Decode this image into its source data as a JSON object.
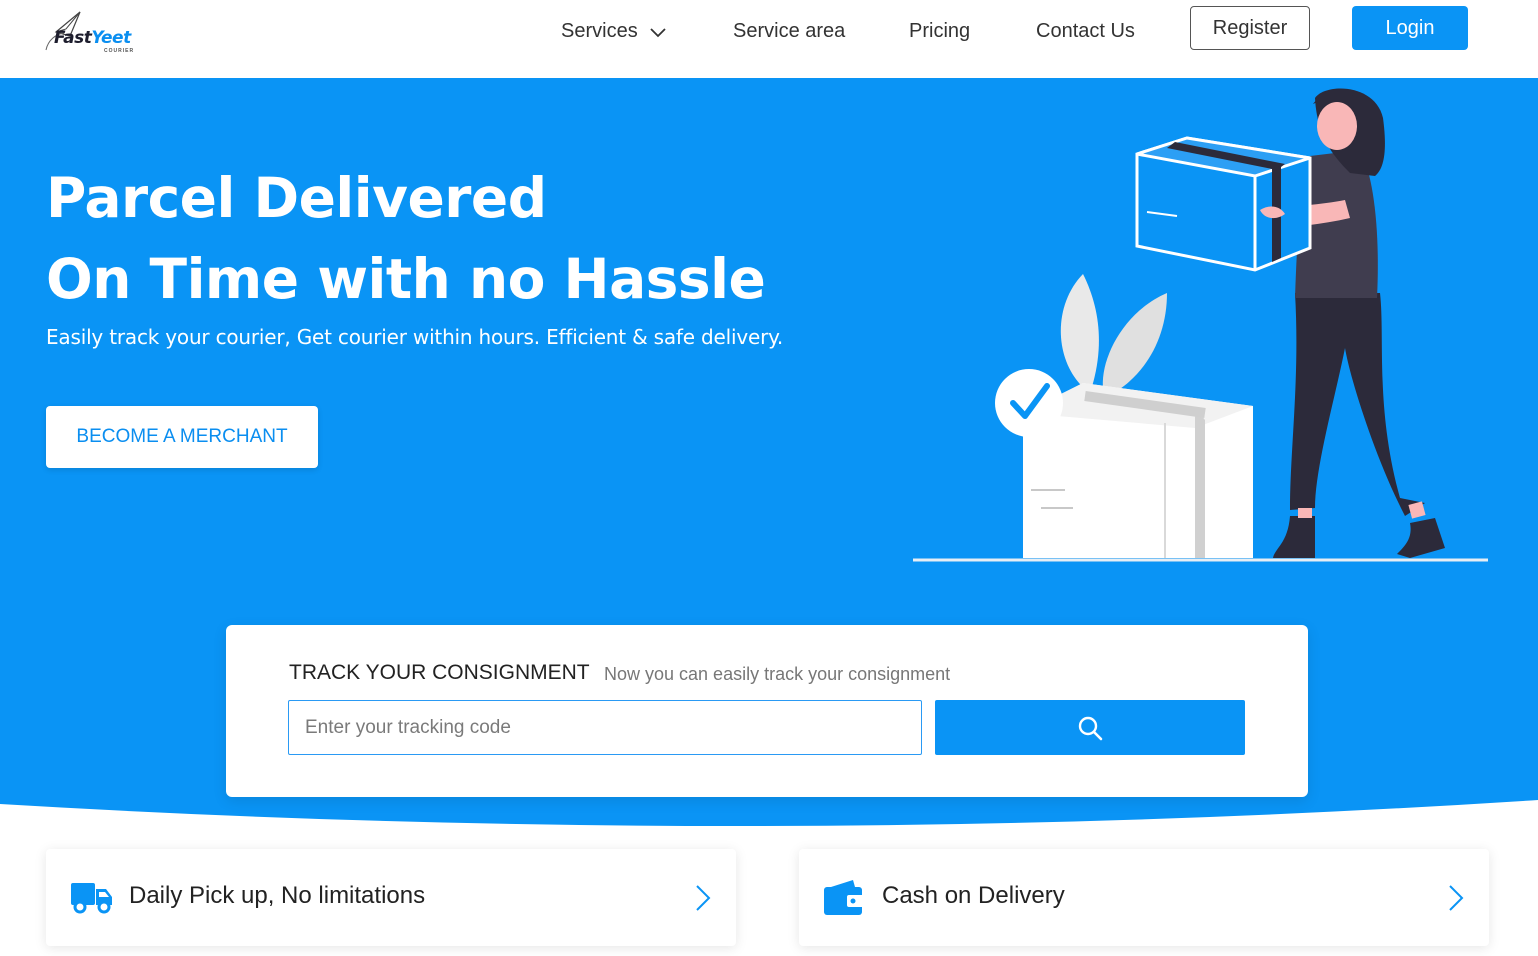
{
  "brand": {
    "name_part1": "Fast",
    "name_part2": "Yeet",
    "tagline": "COURIER",
    "primary_color": "#0a94f5"
  },
  "nav": {
    "items": [
      {
        "label": "Services",
        "has_dropdown": true,
        "icon": "chevron-down-icon"
      },
      {
        "label": "Service area"
      },
      {
        "label": "Pricing"
      },
      {
        "label": "Contact Us"
      }
    ],
    "register_label": "Register",
    "login_label": "Login"
  },
  "hero": {
    "title_line1": "Parcel Delivered",
    "title_line2": "On Time with no Hassle",
    "subtitle": "Easily track your courier, Get courier within hours. Efficient & safe delivery.",
    "cta_label": "BECOME A MERCHANT",
    "background_color": "#0a94f5"
  },
  "tracking": {
    "title": "TRACK YOUR CONSIGNMENT",
    "note": "Now you can easily track your consignment",
    "input_placeholder": "Enter your tracking code",
    "input_value": "",
    "search_icon": "search-icon"
  },
  "features": [
    {
      "label": "Daily Pick up, No limitations",
      "icon": "truck-icon"
    },
    {
      "label": "Cash on Delivery",
      "icon": "wallet-icon"
    }
  ]
}
